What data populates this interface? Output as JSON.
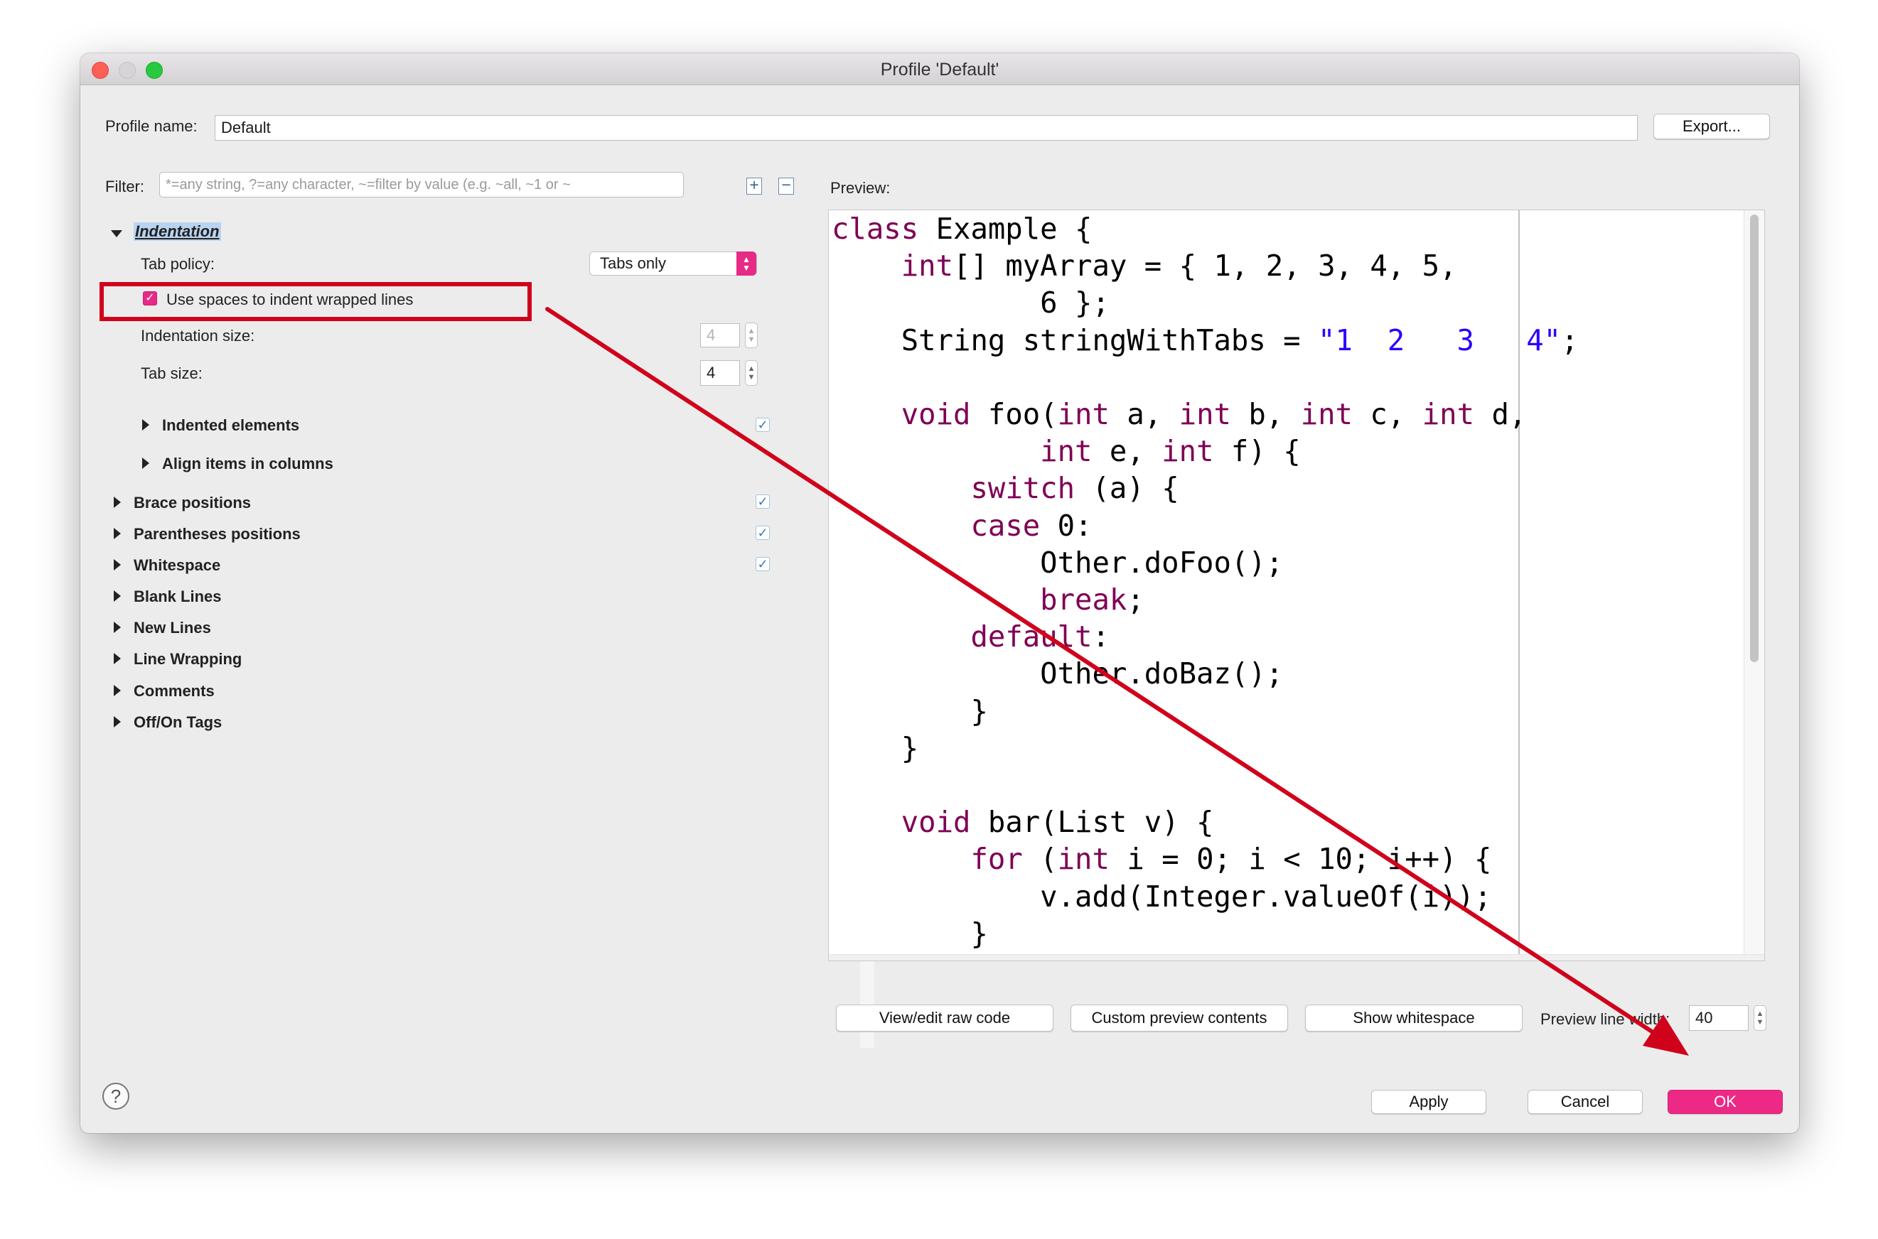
{
  "window": {
    "title": "Profile 'Default'"
  },
  "profile": {
    "label": "Profile name:",
    "value": "Default",
    "export_label": "Export..."
  },
  "filter": {
    "label": "Filter:",
    "placeholder": "*=any string, ?=any character, ~=filter by value (e.g. ~all, ~1 or ~"
  },
  "indentation": {
    "heading": "Indentation",
    "tab_policy_label": "Tab policy:",
    "tab_policy_value": "Tabs only",
    "use_spaces_label": "Use spaces to indent wrapped lines",
    "use_spaces_checked": true,
    "indent_size_label": "Indentation size:",
    "indent_size_value": "4",
    "tab_size_label": "Tab size:",
    "tab_size_value": "4",
    "sub_items": [
      "Indented elements",
      "Align items in columns"
    ]
  },
  "sections": [
    "Brace positions",
    "Parentheses positions",
    "Whitespace",
    "Blank Lines",
    "New Lines",
    "Line Wrapping",
    "Comments",
    "Off/On Tags"
  ],
  "preview": {
    "label": "Preview:",
    "buttons": {
      "raw": "View/edit raw code",
      "custom": "Custom preview contents",
      "whitespace": "Show whitespace"
    },
    "line_width_label": "Preview line width:",
    "line_width_value": "40"
  },
  "footer": {
    "apply": "Apply",
    "cancel": "Cancel",
    "ok": "OK",
    "help": "?"
  },
  "colors": {
    "accent": "#ec2a86",
    "annotation": "#d0021b",
    "keyword": "#7f0055",
    "string": "#2a00ff"
  },
  "icons": [
    "expand-all-icon",
    "collapse-all-icon",
    "help-icon"
  ]
}
